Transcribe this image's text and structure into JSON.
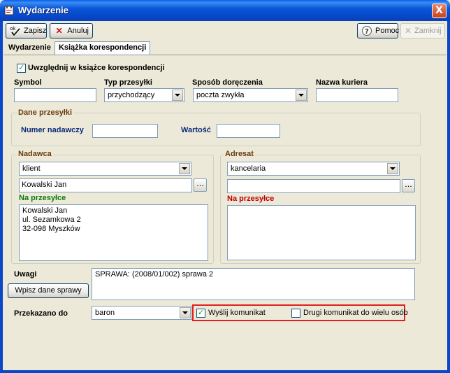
{
  "window": {
    "title": "Wydarzenie",
    "close_glyph": "X"
  },
  "toolbar": {
    "save_label": "Zapisz",
    "cancel_label": "Anuluj",
    "help_label": "Pomoc",
    "close_label": "Zamknij"
  },
  "tabs": [
    {
      "label": "Wydarzenie",
      "active": false
    },
    {
      "label": "Książka korespondencji",
      "active": true
    }
  ],
  "form": {
    "include_in_book": {
      "label": "Uwzględnij w książce korespondencji",
      "checked": true
    },
    "symbol": {
      "label": "Symbol",
      "value": ""
    },
    "shipment_type": {
      "label": "Typ przesyłki",
      "value": "przychodzący"
    },
    "delivery_method": {
      "label": "Sposób doręczenia",
      "value": "poczta zwykła"
    },
    "courier_name": {
      "label": "Nazwa kuriera",
      "value": ""
    },
    "shipment_data": {
      "title": "Dane przesyłki",
      "sender_number_label": "Numer nadawczy",
      "sender_number_value": "",
      "value_label": "Wartość",
      "value_value": ""
    },
    "sender": {
      "title": "Nadawca",
      "type_value": "klient",
      "name_value": "Kowalski Jan",
      "on_shipment_label": "Na przesyłce",
      "on_shipment_text": "Kowalski Jan\nul. Sezamkowa 2\n32-098 Myszków",
      "browse_label": "..."
    },
    "recipient": {
      "title": "Adresat",
      "type_value": "kancelaria",
      "name_value": "",
      "on_shipment_label": "Na przesyłce",
      "on_shipment_text": "",
      "browse_label": "..."
    },
    "notes": {
      "label": "Uwagi",
      "insert_case_button": "Wpisz dane sprawy",
      "value": "SPRAWA: (2008/01/002) sprawa 2"
    },
    "forwarded_to": {
      "label": "Przekazano do",
      "value": "baron",
      "send_message": {
        "label": "Wyślij komunikat",
        "checked": true
      },
      "second_message": {
        "label": "Drugi komunikat do wielu osób",
        "checked": false
      }
    }
  },
  "colors": {
    "titlebar": "#0b56d8",
    "highlight": "#e02020",
    "label_blue": "#0b2b7a",
    "label_green": "#0a7d0a",
    "label_red": "#c00000"
  }
}
